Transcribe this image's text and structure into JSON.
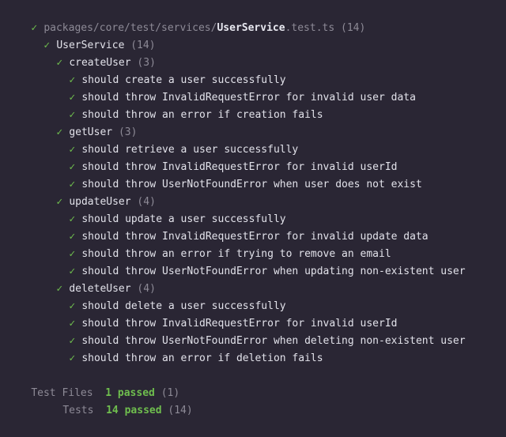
{
  "file": {
    "prefix": "packages/core/test/services/",
    "name": "UserService",
    "suffix": ".test.ts",
    "count": "(14)"
  },
  "root_suite": {
    "name": "UserService",
    "count": "(14)"
  },
  "suites": [
    {
      "name": "createUser",
      "count": "(3)",
      "tests": [
        "should create a user successfully",
        "should throw InvalidRequestError for invalid user data",
        "should throw an error if creation fails"
      ]
    },
    {
      "name": "getUser",
      "count": "(3)",
      "tests": [
        "should retrieve a user successfully",
        "should throw InvalidRequestError for invalid userId",
        "should throw UserNotFoundError when user does not exist"
      ]
    },
    {
      "name": "updateUser",
      "count": "(4)",
      "tests": [
        "should update a user successfully",
        "should throw InvalidRequestError for invalid update data",
        "should throw an error if trying to remove an email",
        "should throw UserNotFoundError when updating non-existent user"
      ]
    },
    {
      "name": "deleteUser",
      "count": "(4)",
      "tests": [
        "should delete a user successfully",
        "should throw InvalidRequestError for invalid userId",
        "should throw UserNotFoundError when deleting non-existent user",
        "should throw an error if deletion fails"
      ]
    }
  ],
  "summary": {
    "files_label": "Test Files",
    "files_passed": "1 passed",
    "files_count": "(1)",
    "tests_label": "Tests",
    "tests_passed": "14 passed",
    "tests_count": "(14)"
  },
  "colors": {
    "background": "#2a2634",
    "check": "#6fbe4e",
    "dim": "#8d8a96"
  },
  "icons": {
    "check": "✓"
  }
}
